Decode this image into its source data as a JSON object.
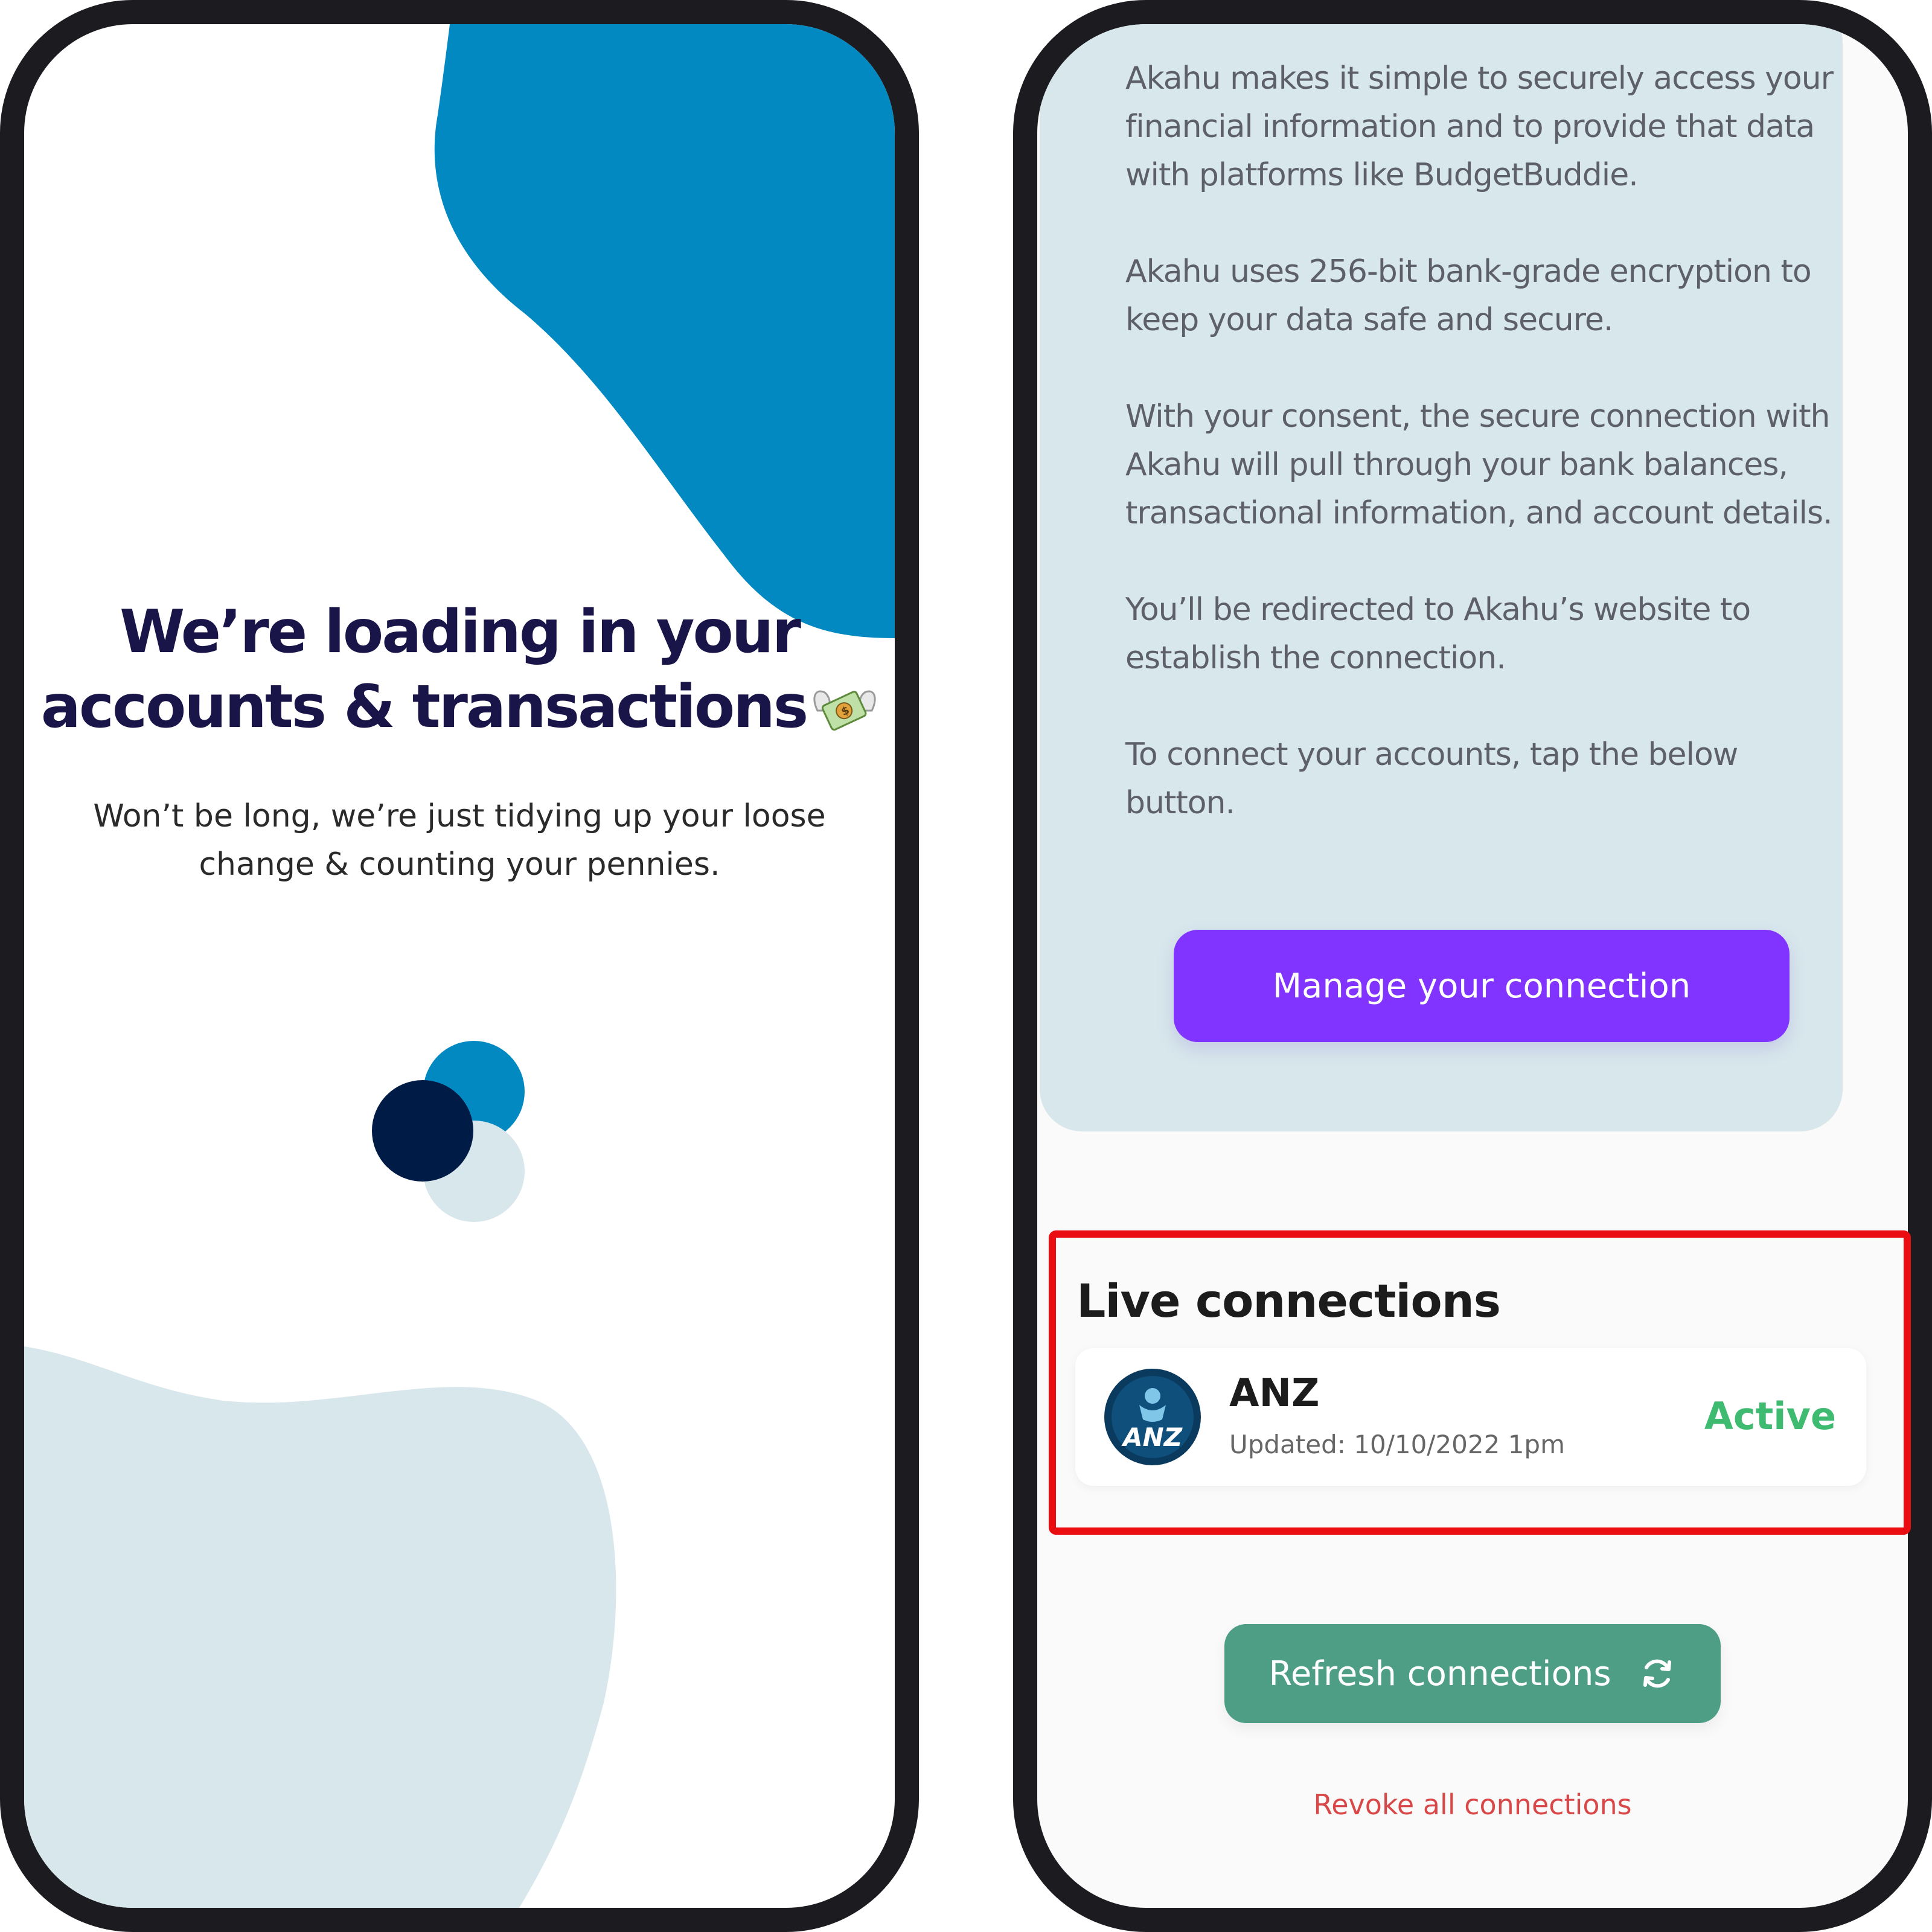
{
  "loading_screen": {
    "title_line1": "We’re loading in your",
    "title_line2": "accounts & transactions",
    "title_emoji": "money-with-wings-icon",
    "subtitle_line1": "Won’t be long, we’re just tidying up your loose",
    "subtitle_line2": "change & counting your pennies."
  },
  "connection_screen": {
    "info_paragraphs": [
      "Akahu makes it simple to securely access your financial information and to provide that data with platforms like BudgetBuddie.",
      "Akahu uses 256-bit bank-grade encryption to keep your data safe and secure.",
      "With your consent, the secure connection with Akahu will pull through your bank balances, transactional information, and account details.",
      "You’ll be redirected to Akahu’s website to establish the connection.",
      "To connect your accounts, tap the below button."
    ],
    "manage_button_label": "Manage your connection",
    "live_connections_title": "Live connections",
    "connections": [
      {
        "logo_text": "ANZ",
        "bank_name": "ANZ",
        "updated": "Updated: 10/10/2022 1pm",
        "status": "Active"
      }
    ],
    "refresh_button_label": "Refresh connections",
    "refresh_icon": "refresh-icon",
    "revoke_link_label": "Revoke all connections"
  },
  "colors": {
    "phone_frame": "#1c1b20",
    "title_navy": "#1a1549",
    "blob_blue": "#0289c1",
    "blob_light": "#d8e7ec",
    "loader_dark": "#001c46",
    "card_bg": "#d8e7ec",
    "manage_button": "#8134ff",
    "refresh_button": "#4d9e84",
    "status_active": "#3ebb71",
    "revoke_red": "#d84848",
    "highlight_red": "#ea0d12"
  }
}
